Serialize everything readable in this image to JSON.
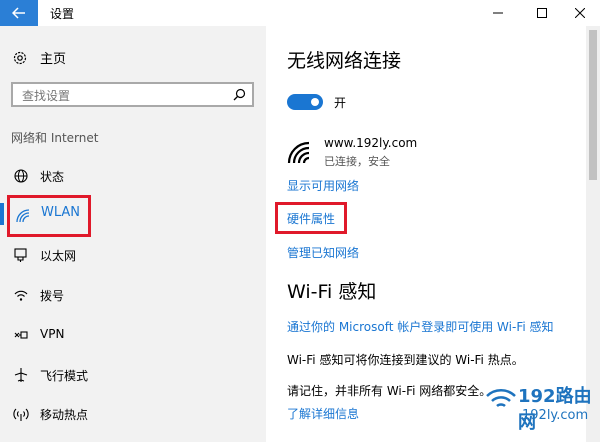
{
  "window": {
    "title": "设置",
    "back_icon": "back-arrow-icon",
    "minimize_icon": "minimize-icon",
    "maximize_icon": "maximize-icon",
    "close_icon": "close-icon"
  },
  "sidebar": {
    "home_label": "主页",
    "search_placeholder": "查找设置",
    "section_title": "网络和 Internet",
    "items": [
      {
        "label": "状态",
        "icon": "globe-status-icon",
        "active": false
      },
      {
        "label": "WLAN",
        "icon": "wifi-icon",
        "active": true
      },
      {
        "label": "以太网",
        "icon": "ethernet-icon",
        "active": false
      },
      {
        "label": "拨号",
        "icon": "dialup-icon",
        "active": false
      },
      {
        "label": "VPN",
        "icon": "vpn-icon",
        "active": false
      },
      {
        "label": "飞行模式",
        "icon": "airplane-icon",
        "active": false
      },
      {
        "label": "移动热点",
        "icon": "hotspot-icon",
        "active": false
      }
    ]
  },
  "main": {
    "wireless_title": "无线网络连接",
    "toggle_label": "开",
    "network": {
      "ssid": "www.192ly.com",
      "status": "已连接，安全"
    },
    "link_show_networks": "显示可用网络",
    "link_hardware": "硬件属性",
    "link_manage": "管理已知网络",
    "wifi_sense_title": "Wi-Fi 感知",
    "link_sign_in": "通过你的 Microsoft 帐户登录即可使用 Wi-Fi 感知",
    "sense_desc": "Wi-Fi 感知可将你连接到建议的 Wi-Fi 热点。",
    "sense_note": "请记住，并非所有 Wi-Fi 网络都安全。",
    "link_learn_more": "了解详细信息"
  },
  "watermark": {
    "name": "192路由网",
    "url": "192ly.com"
  },
  "colors": {
    "accent": "#1a76d2",
    "highlight_box": "#e0192a",
    "sidebar_bg": "#f2f2f2"
  }
}
